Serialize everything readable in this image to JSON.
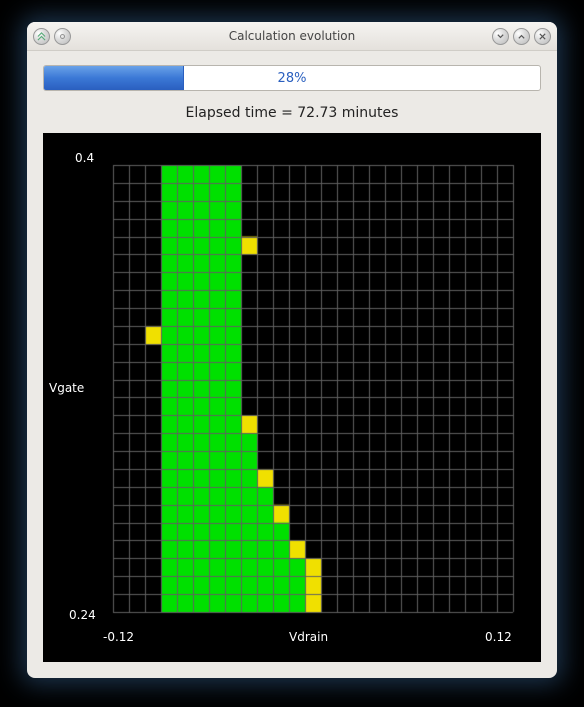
{
  "window": {
    "title": "Calculation evolution"
  },
  "progress": {
    "percent": 28,
    "label": "28%"
  },
  "elapsed": {
    "text": "Elapsed time = 72.73 minutes"
  },
  "chart_data": {
    "type": "heatmap",
    "title": "",
    "xlabel": "Vdrain",
    "ylabel": "Vgate",
    "xlim": [
      -0.12,
      0.12
    ],
    "ylim": [
      0.24,
      0.4
    ],
    "x_ticks": [
      "-0.12",
      "0.12"
    ],
    "y_ticks": [
      "0.4",
      "0.24"
    ],
    "grid_cols": 25,
    "grid_rows": 25,
    "rows_top_to_bottom": [
      [
        0,
        0,
        0,
        1,
        1,
        1,
        1,
        1,
        0,
        0,
        0,
        0,
        0,
        0,
        0,
        0,
        0,
        0,
        0,
        0,
        0,
        0,
        0,
        0,
        0
      ],
      [
        0,
        0,
        0,
        1,
        1,
        1,
        1,
        1,
        0,
        0,
        0,
        0,
        0,
        0,
        0,
        0,
        0,
        0,
        0,
        0,
        0,
        0,
        0,
        0,
        0
      ],
      [
        0,
        0,
        0,
        1,
        1,
        1,
        1,
        1,
        0,
        0,
        0,
        0,
        0,
        0,
        0,
        0,
        0,
        0,
        0,
        0,
        0,
        0,
        0,
        0,
        0
      ],
      [
        0,
        0,
        0,
        1,
        1,
        1,
        1,
        1,
        0,
        0,
        0,
        0,
        0,
        0,
        0,
        0,
        0,
        0,
        0,
        0,
        0,
        0,
        0,
        0,
        0
      ],
      [
        0,
        0,
        0,
        1,
        1,
        1,
        1,
        1,
        2,
        0,
        0,
        0,
        0,
        0,
        0,
        0,
        0,
        0,
        0,
        0,
        0,
        0,
        0,
        0,
        0
      ],
      [
        0,
        0,
        0,
        1,
        1,
        1,
        1,
        1,
        0,
        0,
        0,
        0,
        0,
        0,
        0,
        0,
        0,
        0,
        0,
        0,
        0,
        0,
        0,
        0,
        0
      ],
      [
        0,
        0,
        0,
        1,
        1,
        1,
        1,
        1,
        0,
        0,
        0,
        0,
        0,
        0,
        0,
        0,
        0,
        0,
        0,
        0,
        0,
        0,
        0,
        0,
        0
      ],
      [
        0,
        0,
        0,
        1,
        1,
        1,
        1,
        1,
        0,
        0,
        0,
        0,
        0,
        0,
        0,
        0,
        0,
        0,
        0,
        0,
        0,
        0,
        0,
        0,
        0
      ],
      [
        0,
        0,
        0,
        1,
        1,
        1,
        1,
        1,
        0,
        0,
        0,
        0,
        0,
        0,
        0,
        0,
        0,
        0,
        0,
        0,
        0,
        0,
        0,
        0,
        0
      ],
      [
        0,
        0,
        2,
        1,
        1,
        1,
        1,
        1,
        0,
        0,
        0,
        0,
        0,
        0,
        0,
        0,
        0,
        0,
        0,
        0,
        0,
        0,
        0,
        0,
        0
      ],
      [
        0,
        0,
        0,
        1,
        1,
        1,
        1,
        1,
        0,
        0,
        0,
        0,
        0,
        0,
        0,
        0,
        0,
        0,
        0,
        0,
        0,
        0,
        0,
        0,
        0
      ],
      [
        0,
        0,
        0,
        1,
        1,
        1,
        1,
        1,
        0,
        0,
        0,
        0,
        0,
        0,
        0,
        0,
        0,
        0,
        0,
        0,
        0,
        0,
        0,
        0,
        0
      ],
      [
        0,
        0,
        0,
        1,
        1,
        1,
        1,
        1,
        0,
        0,
        0,
        0,
        0,
        0,
        0,
        0,
        0,
        0,
        0,
        0,
        0,
        0,
        0,
        0,
        0
      ],
      [
        0,
        0,
        0,
        1,
        1,
        1,
        1,
        1,
        0,
        0,
        0,
        0,
        0,
        0,
        0,
        0,
        0,
        0,
        0,
        0,
        0,
        0,
        0,
        0,
        0
      ],
      [
        0,
        0,
        0,
        1,
        1,
        1,
        1,
        1,
        2,
        0,
        0,
        0,
        0,
        0,
        0,
        0,
        0,
        0,
        0,
        0,
        0,
        0,
        0,
        0,
        0
      ],
      [
        0,
        0,
        0,
        1,
        1,
        1,
        1,
        1,
        1,
        0,
        0,
        0,
        0,
        0,
        0,
        0,
        0,
        0,
        0,
        0,
        0,
        0,
        0,
        0,
        0
      ],
      [
        0,
        0,
        0,
        1,
        1,
        1,
        1,
        1,
        1,
        0,
        0,
        0,
        0,
        0,
        0,
        0,
        0,
        0,
        0,
        0,
        0,
        0,
        0,
        0,
        0
      ],
      [
        0,
        0,
        0,
        1,
        1,
        1,
        1,
        1,
        1,
        2,
        0,
        0,
        0,
        0,
        0,
        0,
        0,
        0,
        0,
        0,
        0,
        0,
        0,
        0,
        0
      ],
      [
        0,
        0,
        0,
        1,
        1,
        1,
        1,
        1,
        1,
        1,
        0,
        0,
        0,
        0,
        0,
        0,
        0,
        0,
        0,
        0,
        0,
        0,
        0,
        0,
        0
      ],
      [
        0,
        0,
        0,
        1,
        1,
        1,
        1,
        1,
        1,
        1,
        2,
        0,
        0,
        0,
        0,
        0,
        0,
        0,
        0,
        0,
        0,
        0,
        0,
        0,
        0
      ],
      [
        0,
        0,
        0,
        1,
        1,
        1,
        1,
        1,
        1,
        1,
        1,
        0,
        0,
        0,
        0,
        0,
        0,
        0,
        0,
        0,
        0,
        0,
        0,
        0,
        0
      ],
      [
        0,
        0,
        0,
        1,
        1,
        1,
        1,
        1,
        1,
        1,
        1,
        2,
        0,
        0,
        0,
        0,
        0,
        0,
        0,
        0,
        0,
        0,
        0,
        0,
        0
      ],
      [
        0,
        0,
        0,
        1,
        1,
        1,
        1,
        1,
        1,
        1,
        1,
        1,
        2,
        0,
        0,
        0,
        0,
        0,
        0,
        0,
        0,
        0,
        0,
        0,
        0
      ],
      [
        0,
        0,
        0,
        1,
        1,
        1,
        1,
        1,
        1,
        1,
        1,
        1,
        2,
        0,
        0,
        0,
        0,
        0,
        0,
        0,
        0,
        0,
        0,
        0,
        0
      ],
      [
        0,
        0,
        0,
        1,
        1,
        1,
        1,
        1,
        1,
        1,
        1,
        1,
        2,
        0,
        0,
        0,
        0,
        0,
        0,
        0,
        0,
        0,
        0,
        0,
        0
      ]
    ],
    "color_map": {
      "0": "#000000",
      "1": "#00e000",
      "2": "#f0e000"
    },
    "grid_line_color": "#606060"
  }
}
